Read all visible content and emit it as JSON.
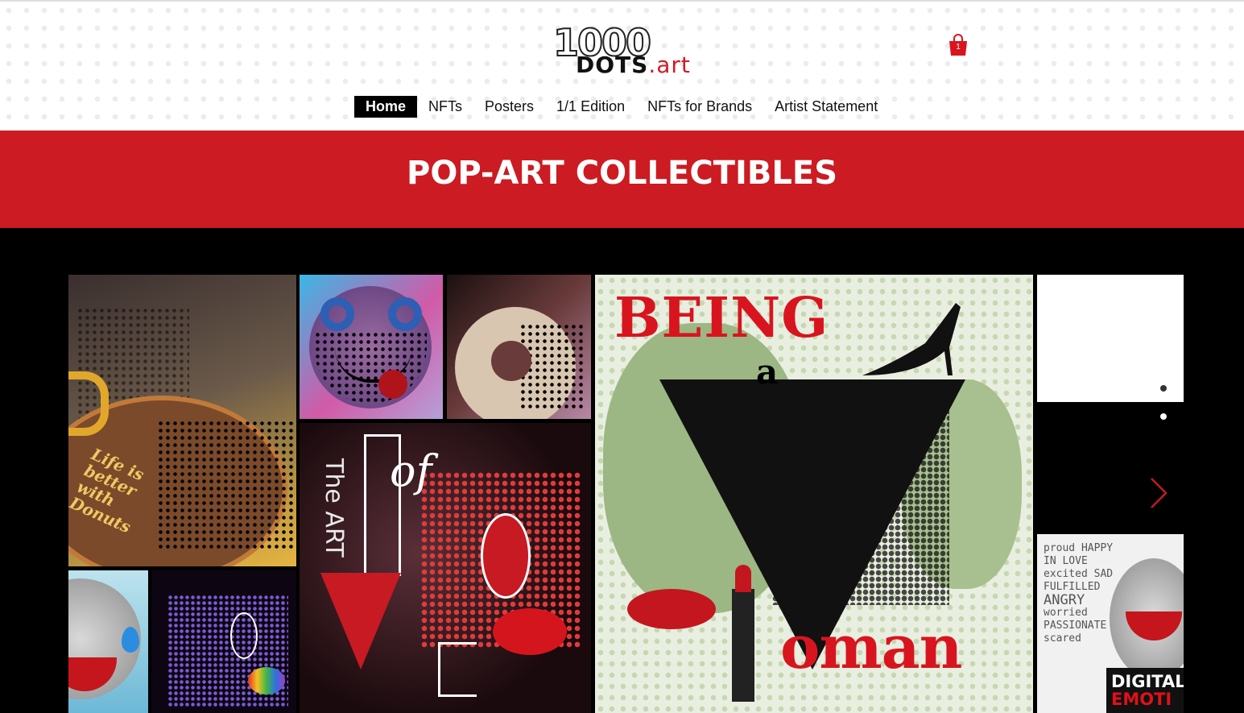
{
  "header": {
    "logo": {
      "number": "1000",
      "dots": "DOTS",
      "art": ".art"
    },
    "cart": {
      "count": "1"
    }
  },
  "nav": {
    "items": [
      {
        "label": "Home",
        "active": true
      },
      {
        "label": "NFTs",
        "active": false
      },
      {
        "label": "Posters",
        "active": false
      },
      {
        "label": "1/1 Edition",
        "active": false
      },
      {
        "label": "NFTs for Brands",
        "active": false
      },
      {
        "label": "Artist Statement",
        "active": false
      }
    ]
  },
  "banner": {
    "title": "POP-ART COLLECTIBLES"
  },
  "gallery": {
    "donut_poster": {
      "text": "Life is better with Donuts"
    },
    "being_woman": {
      "being": "BEING",
      "a": "a",
      "oman": "oman"
    },
    "art_of_love": {
      "the_art": "The ART",
      "of": "of"
    },
    "digital_emotions": {
      "words": [
        "proud HAPPY",
        "IN LOVE",
        "excited SAD",
        "FULFILLED",
        "ANGRY",
        "worried",
        "PASSIONATE",
        "scared"
      ],
      "label_white": "DIGITAL",
      "label_red": "EMOTI"
    }
  },
  "colors": {
    "brand_red": "#cc1b22",
    "nav_active_bg": "#000000",
    "background": "#000000"
  }
}
